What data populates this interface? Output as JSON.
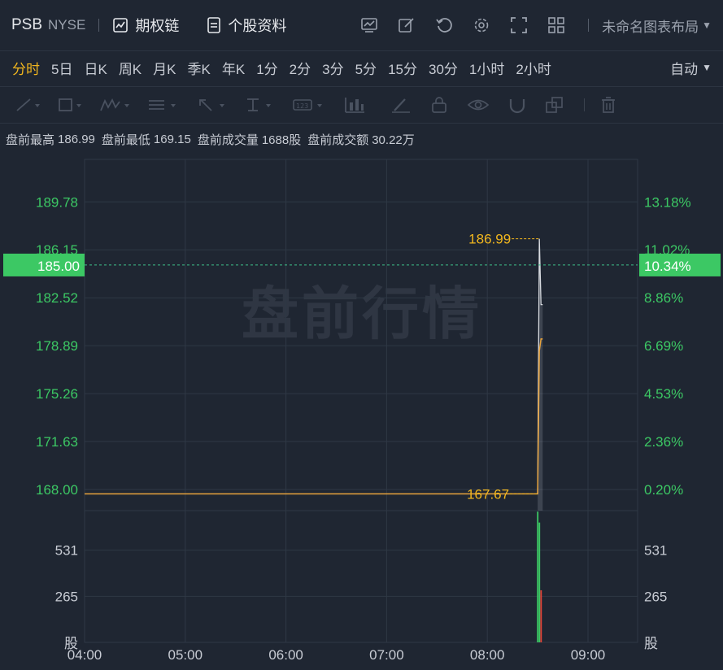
{
  "header": {
    "symbol": "PSB",
    "exchange": "NYSE",
    "options_chain": "期权链",
    "stock_info": "个股资料",
    "layout_name": "未命名图表布局"
  },
  "periods": [
    "分时",
    "5日",
    "日K",
    "周K",
    "月K",
    "季K",
    "年K",
    "1分",
    "2分",
    "3分",
    "5分",
    "15分",
    "30分",
    "1小时",
    "2小时"
  ],
  "active_period": 0,
  "auto_label": "自动",
  "info": {
    "high_label": "盘前最高",
    "high": "186.99",
    "low_label": "盘前最低",
    "low": "169.15",
    "vol_label": "盘前成交量",
    "vol": "1688股",
    "amt_label": "盘前成交额",
    "amt": "30.22万"
  },
  "watermark": "盘前行情",
  "colors": {
    "up": "#3cc864",
    "down": "#e8443a",
    "price_line": "#e8a33c",
    "accent": "#f2b71e",
    "grid": "#2f3845"
  },
  "chart_data": {
    "type": "line",
    "price_axis": {
      "left_ticks": [
        "189.78",
        "186.15",
        "182.52",
        "178.89",
        "175.26",
        "171.63",
        "168.00"
      ],
      "right_ticks": [
        "13.18%",
        "11.02%",
        "8.86%",
        "6.69%",
        "4.53%",
        "2.36%",
        "0.20%"
      ],
      "ylim": [
        166.4,
        193.0
      ]
    },
    "current_price": "185.00",
    "current_pct": "10.34%",
    "max_marker": "186.99",
    "min_marker": "167.67",
    "time_axis": [
      "04:00",
      "05:00",
      "06:00",
      "07:00",
      "08:00",
      "09:00"
    ],
    "price_series": [
      [
        "04:00",
        167.67
      ],
      [
        "08:30",
        167.67
      ],
      [
        "08:31",
        178.5
      ],
      [
        "08:32",
        179.4
      ],
      [
        "08:33",
        179.4
      ]
    ],
    "high_series": [
      [
        "08:30",
        167.67
      ],
      [
        "08:31",
        186.99
      ],
      [
        "08:32",
        182.0
      ],
      [
        "08:33",
        182.0
      ]
    ],
    "volume_axis": {
      "ticks": [
        "531",
        "265"
      ],
      "unit": "股",
      "ylim": [
        0,
        796
      ]
    },
    "volume": [
      {
        "t": "08:30",
        "v": 753,
        "dir": "up"
      },
      {
        "t": "08:31",
        "v": 690,
        "dir": "up"
      },
      {
        "t": "08:32",
        "v": 300,
        "dir": "down"
      }
    ]
  }
}
